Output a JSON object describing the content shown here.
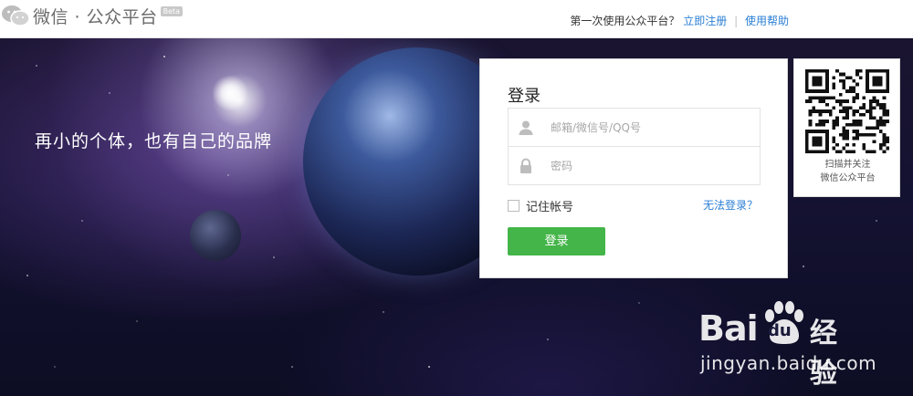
{
  "header": {
    "logo_text": "微信 · 公众平台",
    "beta_label": "Beta",
    "first_time_text": "第一次使用公众平台？",
    "register_link": "立即注册",
    "separator": "|",
    "help_link": "使用帮助"
  },
  "hero": {
    "slogan": "再小的个体，也有自己的品牌"
  },
  "login": {
    "title": "登录",
    "account_placeholder": "邮箱/微信号/QQ号",
    "password_placeholder": "密码",
    "remember_label": "记住帐号",
    "forgot_link": "无法登录？",
    "submit_label": "登录"
  },
  "qr": {
    "caption_line1": "扫描并关注",
    "caption_line2": "微信公众平台"
  },
  "watermark": {
    "brand_left": "Bai",
    "brand_du": "du",
    "brand_right": "经验",
    "url": "jingyan.baidu.com"
  },
  "colors": {
    "accent_green": "#44b549",
    "link_blue": "#2a7fd4"
  }
}
